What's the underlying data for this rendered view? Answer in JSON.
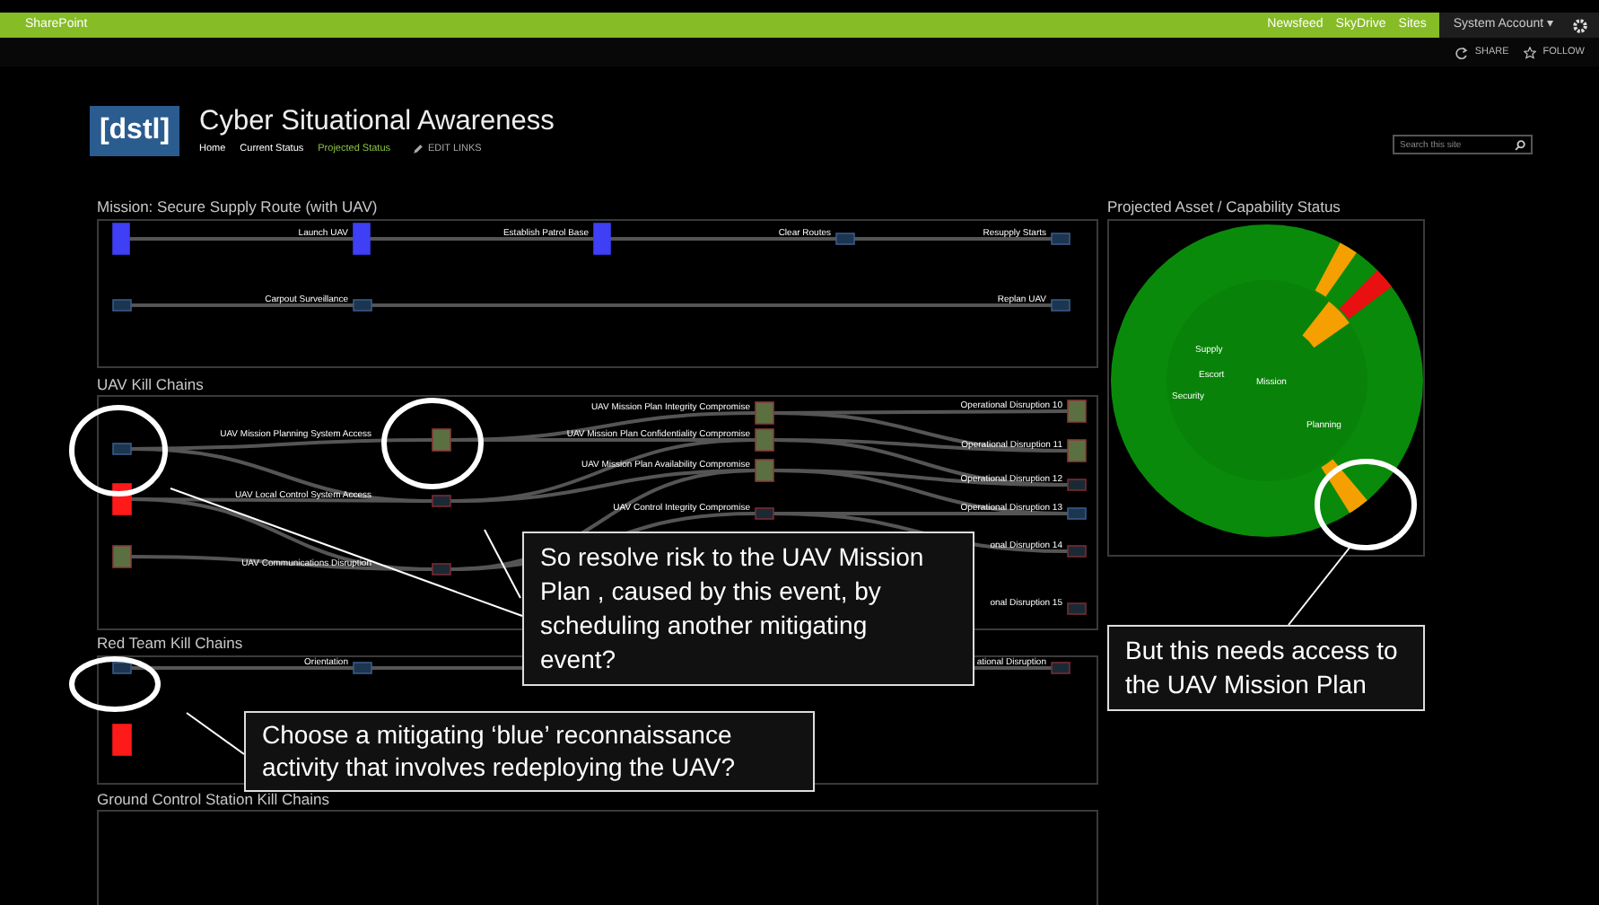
{
  "suite_bar": {
    "brand": "SharePoint",
    "links": [
      {
        "label": "Newsfeed"
      },
      {
        "label": "SkyDrive"
      },
      {
        "label": "Sites"
      }
    ],
    "account": "System Account",
    "account_caret": "▾"
  },
  "actions": [
    {
      "label": "SHARE"
    },
    {
      "label": "FOLLOW"
    }
  ],
  "site": {
    "logo": "[dstl]",
    "title": "Cyber Situational Awareness",
    "nav": [
      {
        "label": "Home",
        "selected": false
      },
      {
        "label": "Current Status",
        "selected": false
      },
      {
        "label": "Projected Status",
        "selected": true
      }
    ],
    "edit_links": "EDIT LINKS",
    "search": {
      "placeholder": "Search this site"
    }
  },
  "mission": {
    "title": "Mission: Secure Supply Route (with UAV)",
    "rows": [
      {
        "cells": [
          {
            "kind": "active"
          },
          {
            "kind": "active",
            "label": "Launch UAV"
          },
          {
            "kind": "active",
            "label": "Establish Patrol Base"
          },
          {
            "kind": "idle",
            "label": "Clear Routes"
          },
          {
            "kind": "idle",
            "label": "Resupply Starts"
          }
        ]
      },
      {
        "cells": [
          {
            "kind": "idle"
          },
          {
            "kind": "idle",
            "label": "Carpout Surveillance"
          },
          {
            "kind": "empty"
          },
          {
            "kind": "empty"
          },
          {
            "kind": "idle",
            "label": "Replan UAV"
          }
        ]
      }
    ]
  },
  "kill_chains": {
    "title": "UAV Kill Chains",
    "columns": [
      {
        "nodes": [
          {
            "kind": "idle"
          },
          {
            "kind": "threat"
          },
          {
            "kind": "risk"
          }
        ]
      },
      {
        "nodes": [
          {
            "kind": "risk",
            "label": "UAV Mission Planning System Access"
          },
          {
            "kind": "dormant",
            "label": "UAV Local Control System Access"
          },
          {
            "kind": "dormant",
            "label": "UAV Communications Disruption"
          }
        ]
      },
      {
        "nodes": [
          {
            "kind": "risk",
            "label": "UAV Mission Plan Integrity Compromise"
          },
          {
            "kind": "risk",
            "label": "UAV Mission Plan Confidentiality Compromise"
          },
          {
            "kind": "risk",
            "label": "UAV Mission Plan Availability Compromise"
          },
          {
            "kind": "dormant",
            "label": "UAV Control Integrity Compromise"
          }
        ]
      },
      {
        "nodes": [
          {
            "kind": "risk",
            "label": "Operational Disruption 10"
          },
          {
            "kind": "risk",
            "label": "Operational Disruption 11"
          },
          {
            "kind": "dormant",
            "label": "Operational Disruption 12"
          },
          {
            "kind": "idle",
            "label": "Operational Disruption 13"
          },
          {
            "kind": "dormant",
            "label": "onal Disruption 14"
          },
          {
            "kind": "dormant",
            "label": "onal Disruption 15"
          }
        ]
      }
    ]
  },
  "red_team": {
    "title": "Red Team Kill Chains",
    "rows": [
      {
        "cells": [
          {
            "kind": "idle"
          },
          {
            "kind": "idle",
            "label": "Orientation"
          },
          {
            "kind": "empty"
          },
          {
            "kind": "empty"
          },
          {
            "kind": "dormant",
            "label": "ational Disruption"
          }
        ]
      },
      {
        "cells": [
          {
            "kind": "threat"
          }
        ]
      }
    ]
  },
  "ground": {
    "title": "Ground Control Station Kill Chains"
  },
  "status_panel": {
    "title": "Projected Asset / Capability Status",
    "sunburst": {
      "center_label": "Mission",
      "labels": [
        {
          "text": "Supply"
        },
        {
          "text": "Escort"
        },
        {
          "text": "Security"
        },
        {
          "text": "Planning"
        }
      ],
      "flagged_segments": [
        {
          "kind": "inner",
          "color": "#f5a000"
        },
        {
          "kind": "outer",
          "color": "#f5a000"
        },
        {
          "kind": "outer",
          "color": "#e81010"
        },
        {
          "kind": "outer",
          "color": "#f5a000"
        }
      ]
    }
  },
  "callouts": [
    {
      "text": "So resolve risk to the UAV Mission Plan , caused by this event, by scheduling another mitigating event?"
    },
    {
      "text": "Choose a mitigating ‘blue’ reconnaissance activity that involves redeploying the UAV?"
    },
    {
      "text": "But this needs access to the UAV Mission Plan"
    }
  ]
}
